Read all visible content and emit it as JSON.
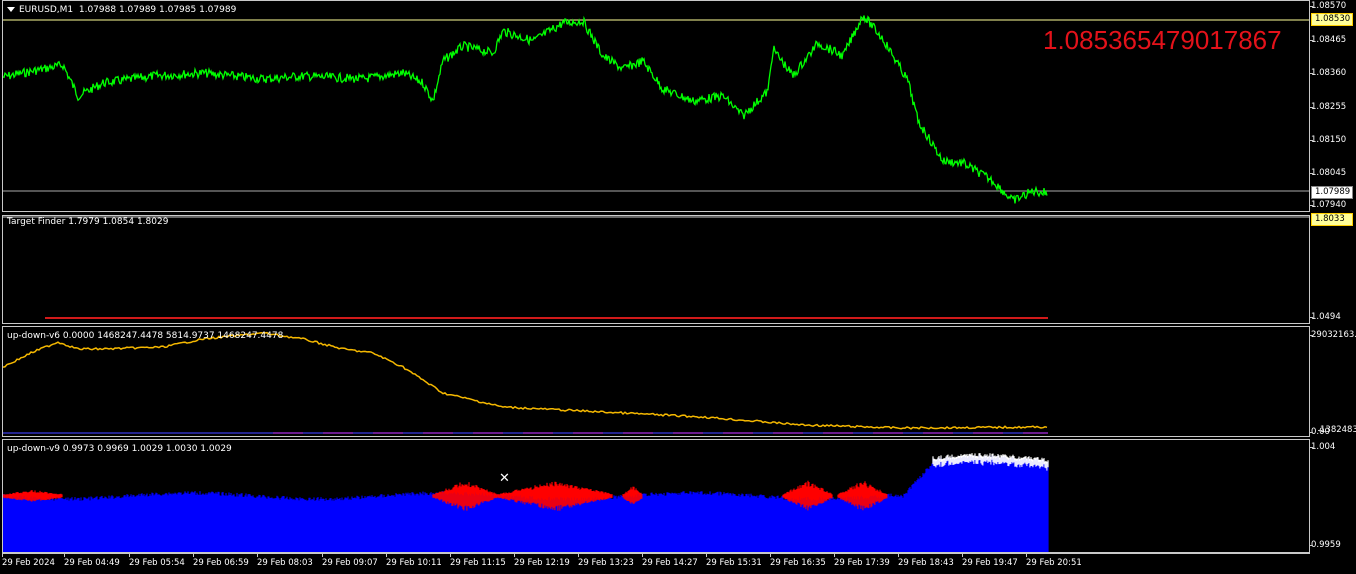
{
  "main_pane": {
    "symbol_label": "EURUSD,M1",
    "ohlc": "1.07988 1.07989 1.07985 1.07989",
    "big_value": "1.08536547901 7867",
    "big_value_text": "1.085365479017867",
    "y_ticks": [
      "1.08570",
      "1.08465",
      "1.08360",
      "1.08255",
      "1.08150",
      "1.08045",
      "1.07940"
    ],
    "high_line_label": "1.08530",
    "current_price_label": "1.07989",
    "line_color": "#00ff00",
    "high_line_color": "#ffff99"
  },
  "target_pane": {
    "label": "Target Finder 1.7979 1.0854 1.8029",
    "top_box": "1.8033",
    "bottom_tick": "1.0494",
    "line_color": "#d11a1a"
  },
  "updown6_pane": {
    "label": "up-down-v6 0.0000 1468247.4478 5814.9737 1468247.4478",
    "top_tick": "29032163.",
    "bottom_tick": "0.00",
    "bottom_tick2": "1382483.",
    "line_color": "#f5b800"
  },
  "updown9_pane": {
    "label": "up-down-v9 0.9973 0.9969 1.0029 1.0030 1.0029",
    "top_tick": "1.004",
    "bottom_tick": "0.9959",
    "fill_color": "#0000ff",
    "accent_color": "#ff0000",
    "marker_color": "#ffffff"
  },
  "time_axis": [
    "29 Feb 2024",
    "29 Feb 04:49",
    "29 Feb 05:54",
    "29 Feb 06:59",
    "29 Feb 08:03",
    "29 Feb 09:07",
    "29 Feb 10:11",
    "29 Feb 11:15",
    "29 Feb 12:19",
    "29 Feb 13:23",
    "29 Feb 14:27",
    "29 Feb 15:31",
    "29 Feb 16:35",
    "29 Feb 17:39",
    "29 Feb 18:43",
    "29 Feb 19:47",
    "29 Feb 20:51"
  ]
}
